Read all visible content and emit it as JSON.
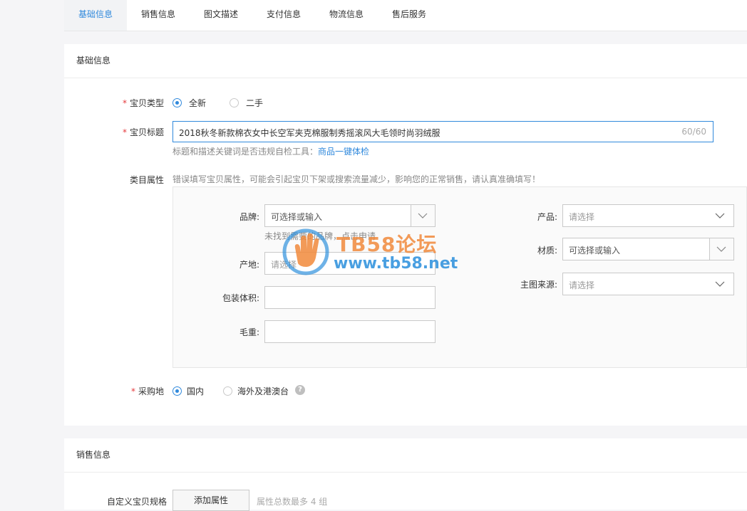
{
  "tabs": [
    "基础信息",
    "销售信息",
    "图文描述",
    "支付信息",
    "物流信息",
    "售后服务"
  ],
  "basic": {
    "section_title": "基础信息",
    "item_type": {
      "label": "宝贝类型",
      "options": [
        "全新",
        "二手"
      ],
      "selected": "全新"
    },
    "item_title": {
      "label": "宝贝标题",
      "value": "2018秋冬新款棉衣女中长空军夹克棉服制秀摇滚风大毛领时尚羽绒服",
      "count": "60/60",
      "hint": "标题和描述关键词是否违规自检工具：",
      "hint_link": "商品一键体检"
    },
    "category_attrs": {
      "label": "类目属性",
      "warning": "错误填写宝贝属性，可能会引起宝贝下架或搜索流量减少，影响您的正常销售，请认真准确填写！",
      "brand_label": "品牌:",
      "brand_placeholder": "可选择或输入",
      "brand_hint": "未找到需要的品牌，点击申请",
      "origin_label": "产地:",
      "origin_placeholder": "请选择",
      "package_label": "包装体积:",
      "weight_label": "毛重:",
      "product_label": "产品:",
      "product_placeholder": "请选择",
      "material_label": "材质:",
      "material_placeholder": "可选择或输入",
      "image_source_label": "主图来源:",
      "image_source_placeholder": "请选择"
    },
    "purchase_location": {
      "label": "采购地",
      "options": [
        "国内",
        "海外及港澳台"
      ],
      "selected": "国内"
    }
  },
  "sales": {
    "section_title": "销售信息",
    "custom_spec_label": "自定义宝贝规格",
    "add_attr_button": "添加属性",
    "attr_limit": "属性总数最多 4 组"
  },
  "watermark": {
    "line1": "TB58论坛",
    "line2": "www.tb58.net"
  },
  "colors": {
    "accent": "#3089dc",
    "required": "#e4393c",
    "watermark_orange": "#f18a3c",
    "watermark_blue": "#2a8fdc"
  }
}
